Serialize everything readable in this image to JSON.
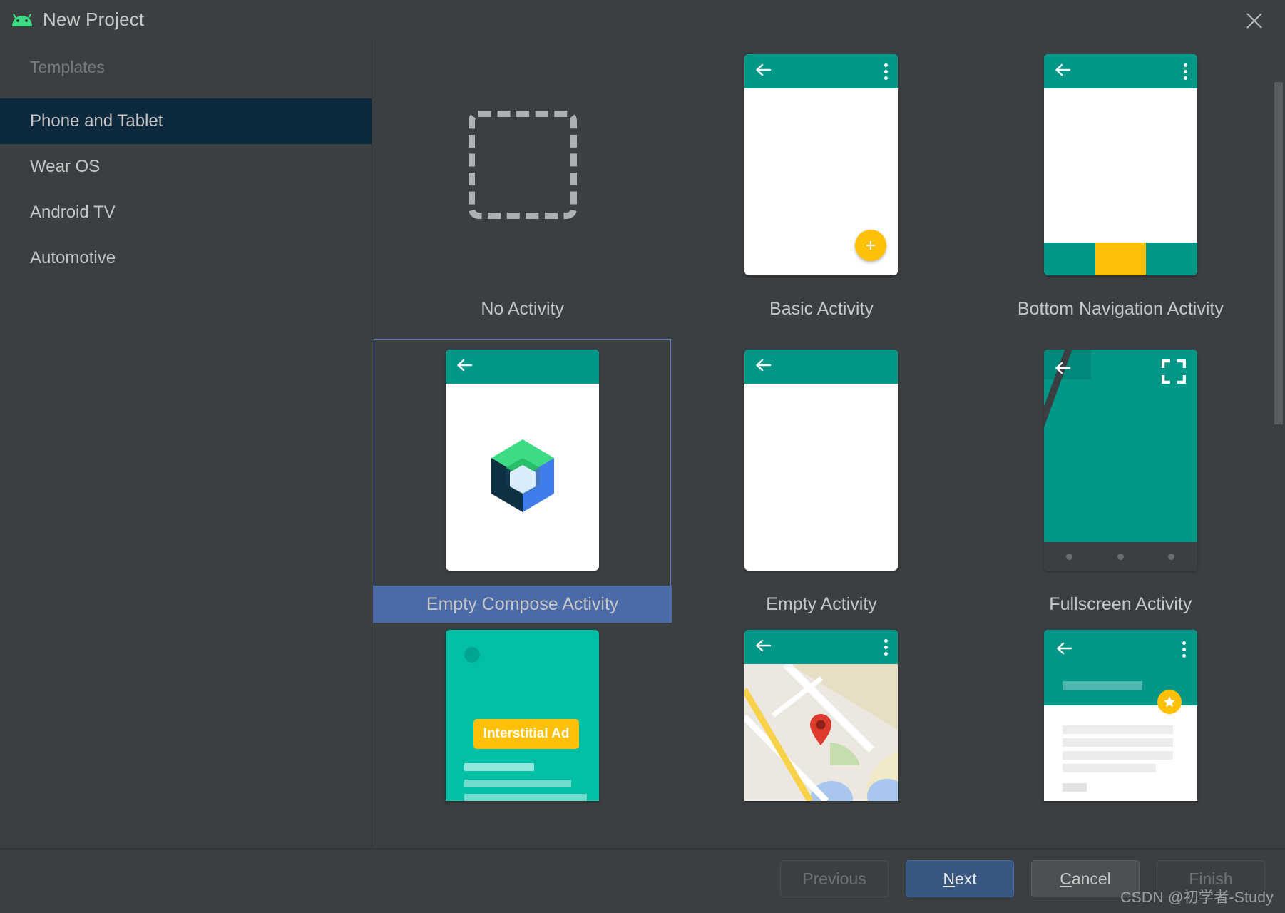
{
  "window": {
    "title": "New Project",
    "logo_icon": "android-logo-icon",
    "close_icon": "close-icon"
  },
  "sidebar": {
    "header": "Templates",
    "items": [
      {
        "label": "Phone and Tablet",
        "selected": true
      },
      {
        "label": "Wear OS",
        "selected": false
      },
      {
        "label": "Android TV",
        "selected": false
      },
      {
        "label": "Automotive",
        "selected": false
      }
    ]
  },
  "templates": [
    {
      "id": "no-activity",
      "label": "No Activity",
      "selected": false
    },
    {
      "id": "basic-activity",
      "label": "Basic Activity",
      "selected": false
    },
    {
      "id": "bottom-navigation",
      "label": "Bottom Navigation Activity",
      "selected": false
    },
    {
      "id": "empty-compose",
      "label": "Empty Compose Activity",
      "selected": true
    },
    {
      "id": "empty-activity",
      "label": "Empty Activity",
      "selected": false
    },
    {
      "id": "fullscreen-activity",
      "label": "Fullscreen Activity",
      "selected": false
    },
    {
      "id": "interstitial-ad",
      "label": "",
      "selected": false
    },
    {
      "id": "google-maps",
      "label": "",
      "selected": false
    },
    {
      "id": "scrolling-activity",
      "label": "",
      "selected": false
    }
  ],
  "card_text": {
    "interstitial_ad_button": "Interstitial Ad"
  },
  "footer": {
    "previous": {
      "label": "Previous",
      "enabled": false
    },
    "next": {
      "label": "Next",
      "enabled": true,
      "mnemonic": "N"
    },
    "cancel": {
      "label": "Cancel",
      "enabled": true,
      "mnemonic": "C"
    },
    "finish": {
      "label": "Finish",
      "enabled": false
    }
  },
  "watermark": "CSDN @初学者-Study",
  "colors": {
    "window_bg": "#3c3f41",
    "sidebar_selected": "#0d293e",
    "selection_band": "#4a6ba8",
    "selection_border": "#5781c4",
    "teal": "#009688",
    "teal_bright": "#00bfa5",
    "amber": "#ffc107",
    "primary_button": "#365880"
  }
}
